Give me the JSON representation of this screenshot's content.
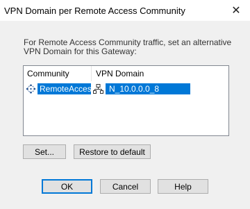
{
  "dialog": {
    "title": "VPN Domain per Remote Access Community",
    "close_glyph": "✕",
    "description_line1": "For Remote Access Community traffic, set an alternative",
    "description_line2": "VPN Domain for this Gateway:"
  },
  "table": {
    "columns": [
      "Community",
      "VPN Domain"
    ],
    "rows": [
      {
        "community": "RemoteAccess",
        "community_icon": "remote-access-community-icon",
        "vpn_domain": "N_10.0.0.0_8",
        "vpn_domain_icon": "network-icon",
        "selected": true
      }
    ]
  },
  "buttons": {
    "set": "Set...",
    "restore": "Restore to default",
    "ok": "OK",
    "cancel": "Cancel",
    "help": "Help"
  },
  "colors": {
    "selection": "#0078d7",
    "default_button_border": "#0078d7"
  }
}
